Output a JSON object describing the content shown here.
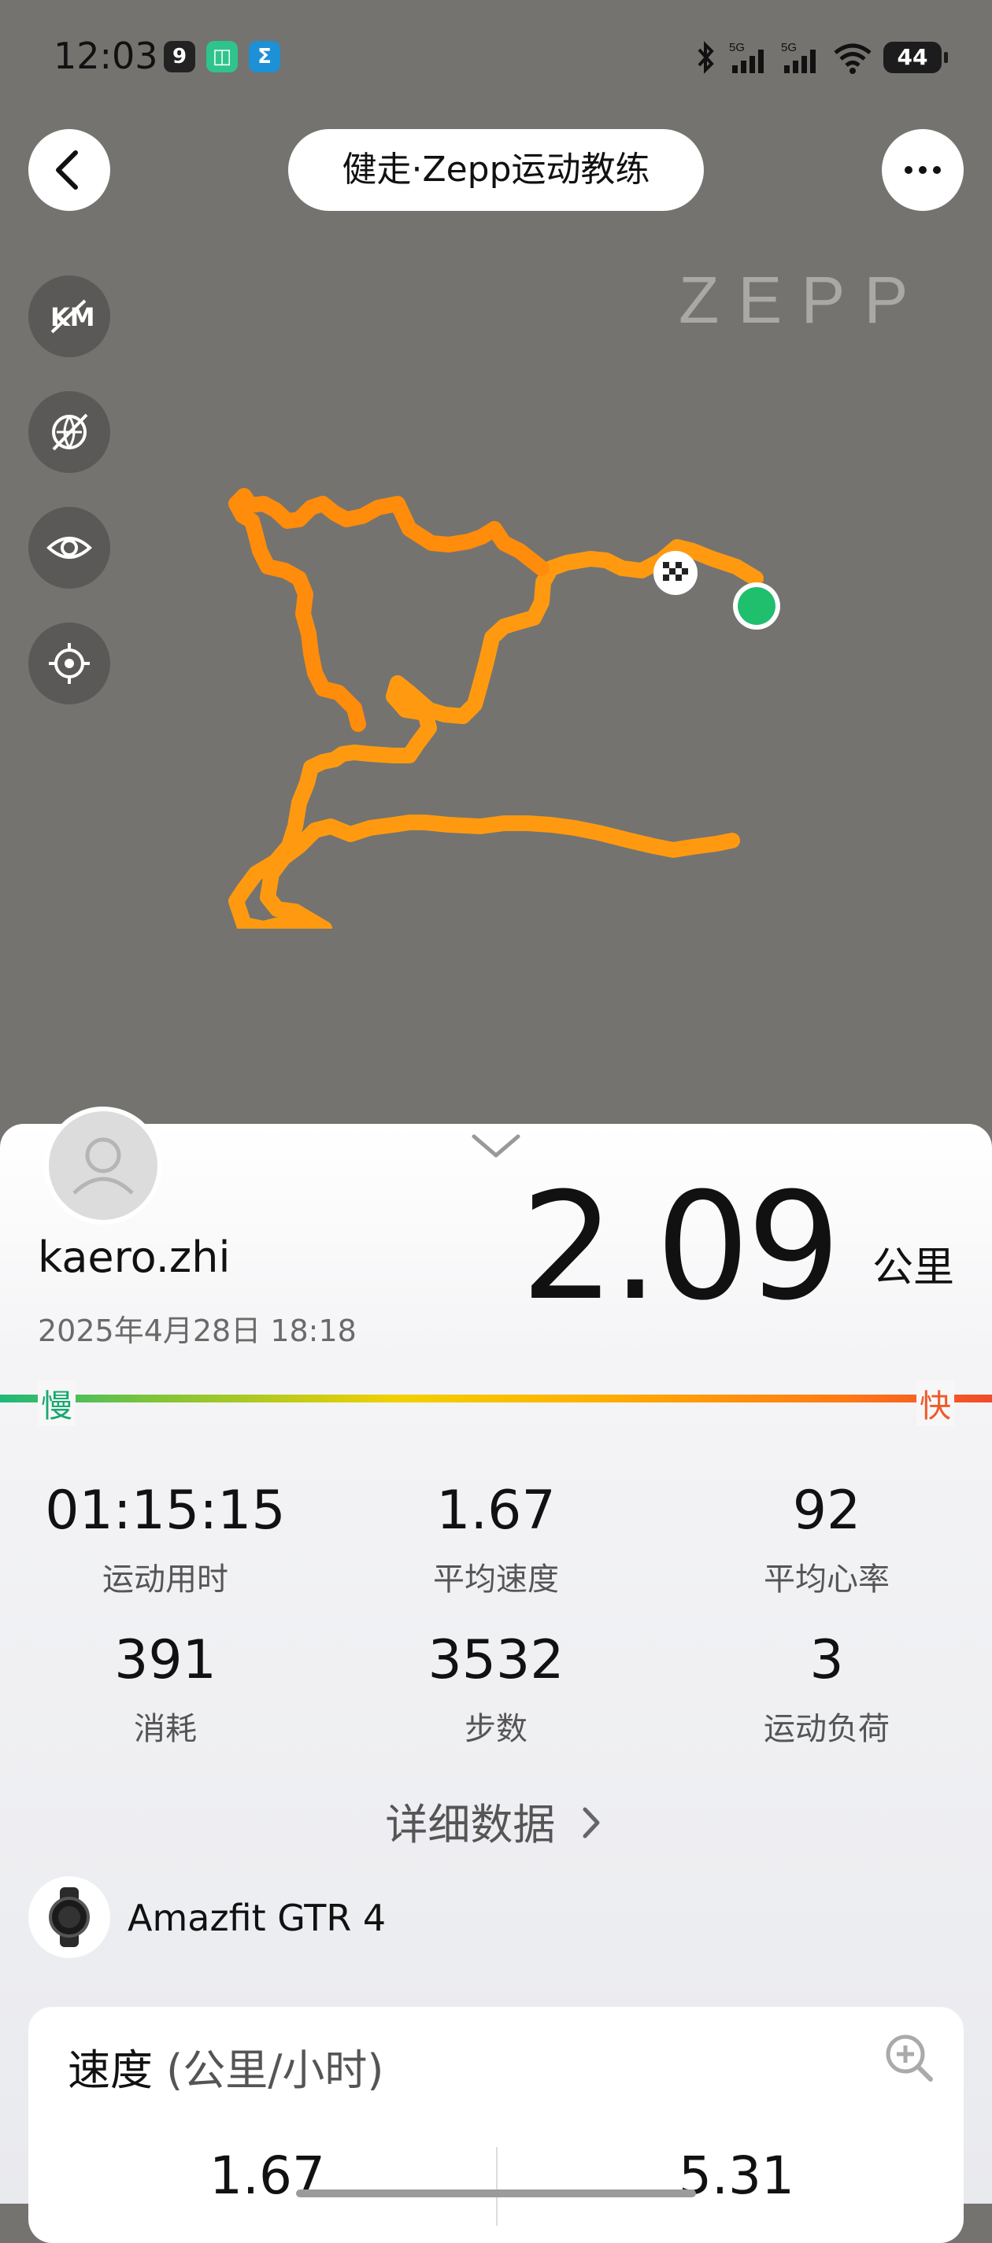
{
  "status_bar": {
    "time": "12:03",
    "network": "5G",
    "battery": "44"
  },
  "nav": {
    "title": "健走·Zepp运动教练"
  },
  "map": {
    "watermark": "ZEPP"
  },
  "summary": {
    "username": "kaero.zhi",
    "datetime": "2025年4月28日 18:18",
    "distance": "2.09",
    "distance_unit": "公里",
    "slow_label": "慢",
    "fast_label": "快"
  },
  "stats": [
    {
      "value": "01:15:15",
      "label": "运动用时"
    },
    {
      "value": "1.67",
      "label": "平均速度"
    },
    {
      "value": "92",
      "label": "平均心率"
    },
    {
      "value": "391",
      "label": "消耗"
    },
    {
      "value": "3532",
      "label": "步数"
    },
    {
      "value": "3",
      "label": "运动负荷"
    }
  ],
  "detail_link": "详细数据",
  "device": {
    "name": "Amazfit GTR 4"
  },
  "speed_card": {
    "title": "速度",
    "unit": "(公里/小时)",
    "value_left": "1.67",
    "value_right": "5.31"
  },
  "colors": {
    "map_bg": "#747370",
    "route": "#ff9a10",
    "start_marker": "#1fbf6e",
    "slow": "#18a870",
    "fast": "#ef5a2a"
  }
}
